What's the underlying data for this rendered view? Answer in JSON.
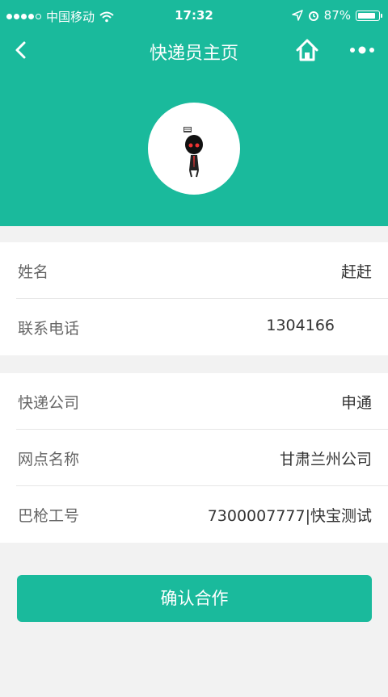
{
  "status_bar": {
    "carrier": "中国移动",
    "time": "17:32",
    "battery": "87%",
    "battery_level": 0.87,
    "signal_bars": 4,
    "icons": [
      "signal-dots-icon",
      "wifi-icon",
      "location-arrow-icon",
      "alarm-icon",
      "battery-icon"
    ]
  },
  "navbar": {
    "title": "快递员主页",
    "icons": [
      "back-chevron-icon",
      "home-icon",
      "more-dots-icon"
    ]
  },
  "colors": {
    "accent": "#1aba9c",
    "background": "#f2f2f2",
    "card": "#ffffff",
    "label_text": "#666666",
    "value_text": "#333333"
  },
  "profile": {
    "fields": [
      {
        "label": "姓名",
        "value": "赶赶"
      },
      {
        "label": "联系电话",
        "value": "1304166"
      }
    ]
  },
  "company": {
    "fields": [
      {
        "label": "快递公司",
        "value": "申通"
      },
      {
        "label": "网点名称",
        "value": "甘肃兰州公司"
      },
      {
        "label": "巴枪工号",
        "value": "7300007777|快宝测试"
      }
    ]
  },
  "actions": {
    "confirm_label": "确认合作"
  }
}
